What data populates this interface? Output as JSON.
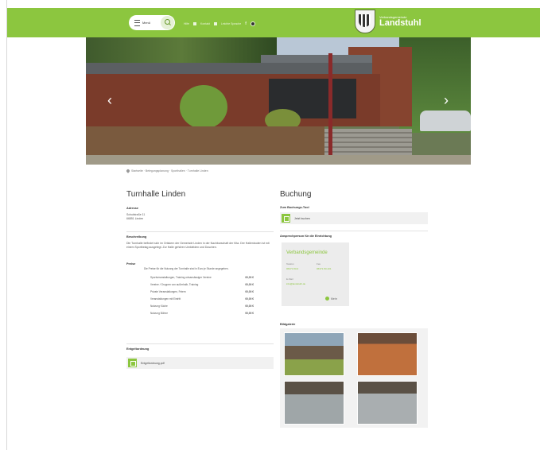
{
  "header": {
    "menu_label": "Menü",
    "links": [
      "Hilfe",
      "Kontakt",
      "Leichte Sprache",
      "f",
      ""
    ],
    "logo_small": "Verbandsgemeinde",
    "logo_big": "Landstuhl"
  },
  "hero": {
    "prev_arrow": "‹",
    "next_arrow": "›"
  },
  "breadcrumb": "Startseite · Belegungsplanung · Sporthallen · Turnhalle Linden",
  "left": {
    "title": "Turnhalle Linden",
    "address_heading": "Adresse",
    "address_lines": [
      "Schulstraße 11",
      "66851 Linden"
    ],
    "description_heading": "Beschreibung",
    "description": "Die Turnhalle befindet sich im Ortskern der Gemeinde Linden in der Nachbarschaft der Kita. Der Hallenboden ist mit einem Sportbelag ausgelegt. Zur Halle gehören Umkleiden und Duschen.",
    "prices_heading": "Preise",
    "prices_intro": "Die Preise für die Nutzung der Turnhalle sind in Euro je Stunde angegeben.",
    "uses": [
      {
        "name": "Sportveranstaltungen, Training ortsansässiger Vereine",
        "price": "00,00 €"
      },
      {
        "name": "Vereine / Gruppen von außerhalb, Training",
        "price": "00,00 €"
      },
      {
        "name": "Private Veranstaltungen, Feiern",
        "price": "00,00 €"
      },
      {
        "name": "Veranstaltungen mit Eintritt",
        "price": "00,00 €"
      },
      {
        "name": "Nutzung Küche",
        "price": "00,00 €"
      },
      {
        "name": "Nutzung Bühne",
        "price": "00,00 €"
      }
    ],
    "booking_order_heading": "Entgeltordnung",
    "booking_order_file": "Entgeltordnung.pdf"
  },
  "right": {
    "title": "Buchung",
    "booking_heading": "Zum Buchungs-Tool",
    "booking_link": "Jetzt buchen",
    "contact_heading": "Ansprechperson für die Einrichtung",
    "contact_name": "Verbandsgemeinde",
    "contact_phone_label": "Telefon",
    "contact_phone": "06371 83-0",
    "contact_fax_label": "Fax",
    "contact_fax": "06371 83-101",
    "contact_email_label": "E-Mail",
    "contact_email": "info@landstuhl.de",
    "contact_more": "Mehr",
    "gallery_heading": "Bildgalerie"
  },
  "colors": {
    "brand_green": "#8cc63f",
    "red_dots": "#d9262c"
  }
}
